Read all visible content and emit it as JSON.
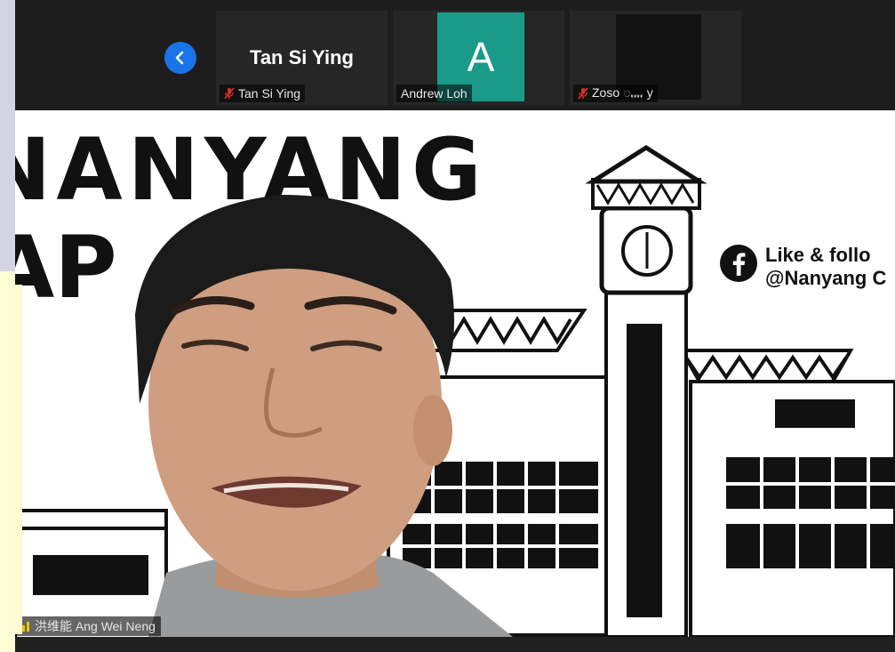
{
  "sidebar": {
    "nav_icon": "chevron-left-icon"
  },
  "participants": [
    {
      "name": "Tan Si Ying",
      "display_title": "Tan Si Ying",
      "muted": true,
      "mute_icon": "mic-muted-icon"
    },
    {
      "name": "Andrew Loh",
      "avatar_letter": "A",
      "avatar_color": "#1a9a88",
      "muted": false
    },
    {
      "name": "Zoso ꩻꩻꩻꩻ y",
      "muted": true,
      "mute_icon": "mic-muted-icon"
    }
  ],
  "background": {
    "banner_text": "NANYANG",
    "facebook_line1": "Like & follo",
    "facebook_line2": "@Nanyang C",
    "facebook_icon": "facebook-icon"
  },
  "active_speaker": {
    "name": "洪维能 Ang Wei Neng",
    "signal_icon": "signal-bars-icon"
  },
  "colors": {
    "accent": "#1a73e8",
    "strip_bg": "#1d1d1d",
    "avatar_green": "#1a9a88"
  }
}
